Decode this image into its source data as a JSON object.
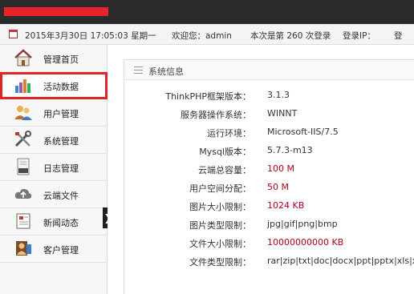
{
  "info_bar": {
    "datetime": "2015年3月30日 17:05:03 星期一",
    "welcome_prefix": "欢迎您：",
    "username": "admin",
    "login_prefix": "本次是第",
    "login_count": "260",
    "login_suffix": "次登录",
    "login_ip_label": "登录IP：",
    "truncated": "登"
  },
  "sidebar": {
    "items": [
      {
        "label": "管理首页",
        "icon": "home-icon"
      },
      {
        "label": "活动数据",
        "icon": "bar-chart-icon"
      },
      {
        "label": "用户管理",
        "icon": "users-icon"
      },
      {
        "label": "系统管理",
        "icon": "tools-icon"
      },
      {
        "label": "日志管理",
        "icon": "log-icon"
      },
      {
        "label": "云端文件",
        "icon": "cloud-upload-icon"
      },
      {
        "label": "新闻动态",
        "icon": "news-icon"
      },
      {
        "label": "客户管理",
        "icon": "customer-icon"
      }
    ],
    "active_index": 1,
    "toggle_glyph": "❯"
  },
  "panel": {
    "title": "系统信息",
    "rows": [
      {
        "key": "ThinkPHP框架版本：",
        "value": "3.1.3",
        "highlight": false
      },
      {
        "key": "服务器操作系统：",
        "value": "WINNT",
        "highlight": false
      },
      {
        "key": "运行环境：",
        "value": "Microsoft-IIS/7.5",
        "highlight": false
      },
      {
        "key": "Mysql版本：",
        "value": "5.7.3-m13",
        "highlight": false
      },
      {
        "key": "云端总容量：",
        "value": "100 M",
        "highlight": true
      },
      {
        "key": "用户空间分配：",
        "value": "50 M",
        "highlight": true
      },
      {
        "key": "图片大小限制：",
        "value": "1024 KB",
        "highlight": true
      },
      {
        "key": "图片类型限制：",
        "value": "jpg|gif|png|bmp",
        "highlight": false
      },
      {
        "key": "文件大小限制：",
        "value": "10000000000 KB",
        "highlight": true
      },
      {
        "key": "文件类型限制：",
        "value": "rar|zip|txt|doc|docx|ppt|pptx|xls|xlsx",
        "highlight": false
      }
    ]
  },
  "colors": {
    "accent_red": "#e02424",
    "value_red": "#b0001a",
    "topbar": "#2b2b2b"
  }
}
